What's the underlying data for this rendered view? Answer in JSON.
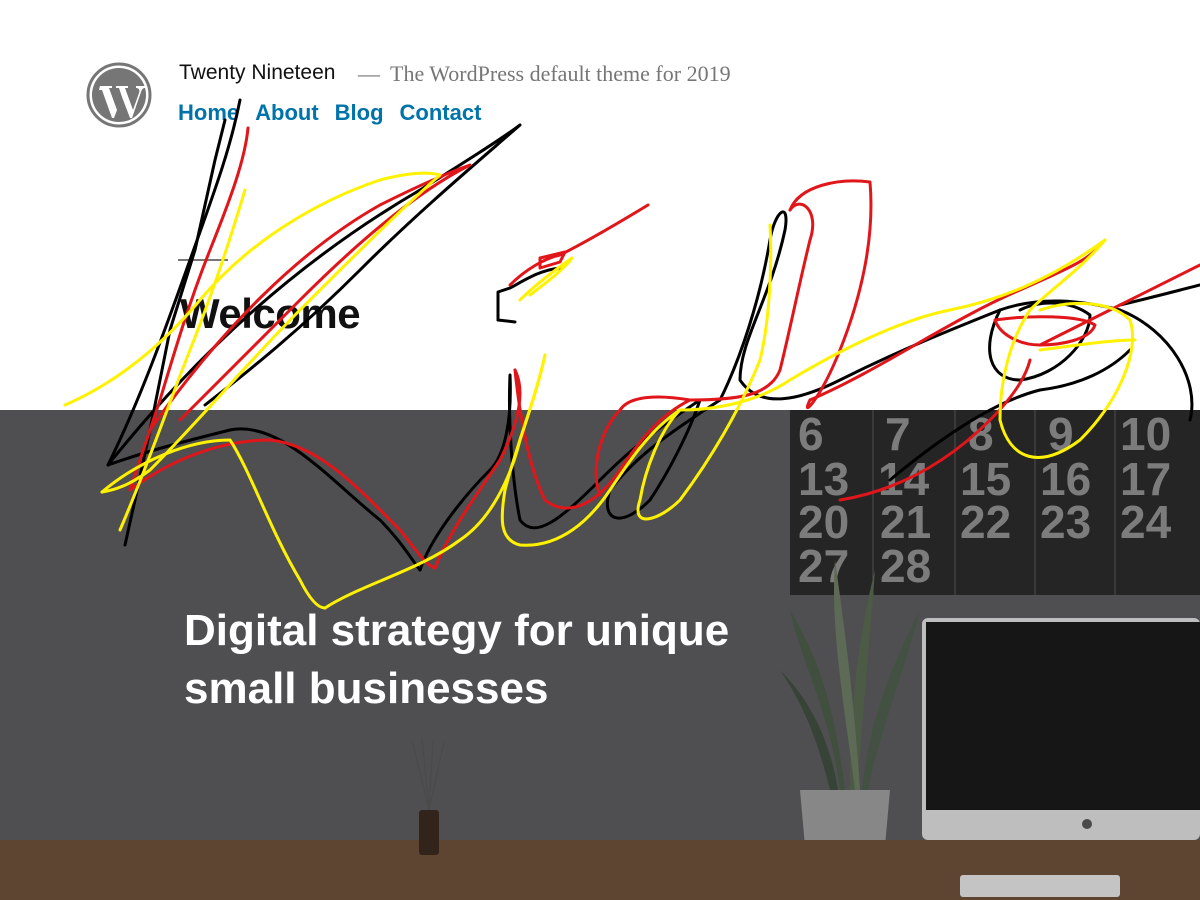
{
  "header": {
    "site_title": "Twenty Nineteen",
    "dash": "—",
    "site_description": "The WordPress default theme for 2019",
    "logo_icon": "wordpress-logo-icon"
  },
  "nav": {
    "items": [
      {
        "label": "Home"
      },
      {
        "label": "About"
      },
      {
        "label": "Blog"
      },
      {
        "label": "Contact"
      }
    ]
  },
  "page": {
    "title": "Welcome"
  },
  "cover": {
    "heading": "Digital strategy for unique small businesses",
    "calendar_numbers": [
      "6",
      "7",
      "8",
      "9",
      "10",
      "13",
      "14",
      "15",
      "16",
      "17",
      "20",
      "21",
      "22",
      "23",
      "24",
      "27",
      "28"
    ]
  },
  "colors": {
    "link": "#0073aa",
    "text": "#111111",
    "muted": "#767676",
    "cover_overlay": "#5a5a5c",
    "scribble_black": "#000000",
    "scribble_red": "#e0161a",
    "scribble_yellow": "#fff200"
  }
}
